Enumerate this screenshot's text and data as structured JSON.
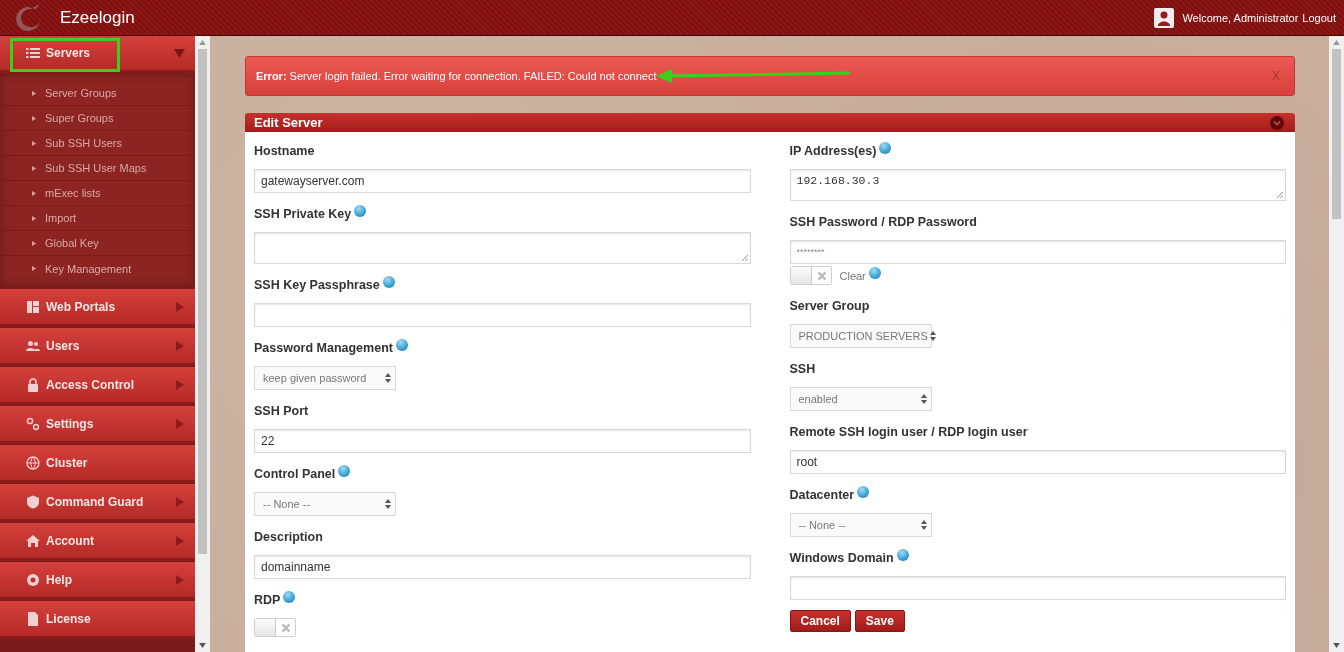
{
  "header": {
    "app_name": "Ezeelogin",
    "welcome": "Welcome, Administrator",
    "logout": "Logout"
  },
  "sidebar": {
    "items": [
      {
        "label": "Servers",
        "expanded": true,
        "highlighted": true,
        "children": [
          {
            "label": "Server Groups"
          },
          {
            "label": "Super Groups"
          },
          {
            "label": "Sub SSH Users"
          },
          {
            "label": "Sub SSH User Maps"
          },
          {
            "label": "mExec lists"
          },
          {
            "label": "Import"
          },
          {
            "label": "Global Key"
          },
          {
            "label": "Key Management"
          }
        ]
      },
      {
        "label": "Web Portals",
        "expanded": false,
        "highlighted": false
      },
      {
        "label": "Users",
        "expanded": false,
        "highlighted": false
      },
      {
        "label": "Access Control",
        "expanded": false,
        "highlighted": false
      },
      {
        "label": "Settings",
        "expanded": false,
        "highlighted": false
      },
      {
        "label": "Cluster",
        "highlighted": false
      },
      {
        "label": "Command Guard",
        "expanded": false,
        "highlighted": false
      },
      {
        "label": "Account",
        "expanded": false,
        "highlighted": false
      },
      {
        "label": "Help",
        "expanded": false,
        "highlighted": false
      },
      {
        "label": "License",
        "highlighted": false
      }
    ]
  },
  "alert": {
    "message": "**Error:** Server login failed. Error waiting for connection. FAILED: Could not connect",
    "close": "X",
    "annotated": true
  },
  "panel": {
    "title": "Edit Server",
    "columns": [
      [
        {
          "kind": "input",
          "label": "Hostname",
          "help": false,
          "value": "gatewayserver.com"
        },
        {
          "kind": "textarea",
          "label": "SSH Private Key",
          "help": true
        },
        {
          "kind": "input",
          "label": "SSH Key Passphrase",
          "help": true
        },
        {
          "kind": "select",
          "label": "Password Management",
          "help": true,
          "value": "keep given password"
        },
        {
          "kind": "input",
          "label": "SSH Port",
          "help": false,
          "value": "22"
        },
        {
          "kind": "select",
          "label": "Control Panel",
          "help": true,
          "value": "-- None --"
        },
        {
          "kind": "input",
          "label": "Description",
          "help": false,
          "value": "domainname"
        },
        {
          "kind": "toggle",
          "label": "RDP",
          "help": true,
          "on": false
        }
      ],
      [
        {
          "kind": "textarea",
          "label": "IP Address(es)",
          "help": true,
          "value": "192.168.30.3",
          "mono": true
        },
        {
          "kind": "password",
          "label": "SSH Password / RDP Password",
          "help": false,
          "placeholder": "********",
          "clear": {
            "label": "Clear",
            "help": true,
            "on": false
          }
        },
        {
          "kind": "select",
          "label": "Server Group",
          "help": false,
          "value": "PRODUCTION SERVERS"
        },
        {
          "kind": "select",
          "label": "SSH",
          "help": false,
          "value": "enabled"
        },
        {
          "kind": "input",
          "label": "Remote SSH login user / RDP login user",
          "help": false,
          "value": "root"
        },
        {
          "kind": "select",
          "label": "Datacenter",
          "help": true,
          "value": "-- None --"
        },
        {
          "kind": "input",
          "label": "Windows Domain",
          "help": true
        }
      ]
    ],
    "buttons": [
      "Cancel",
      "Save"
    ]
  }
}
